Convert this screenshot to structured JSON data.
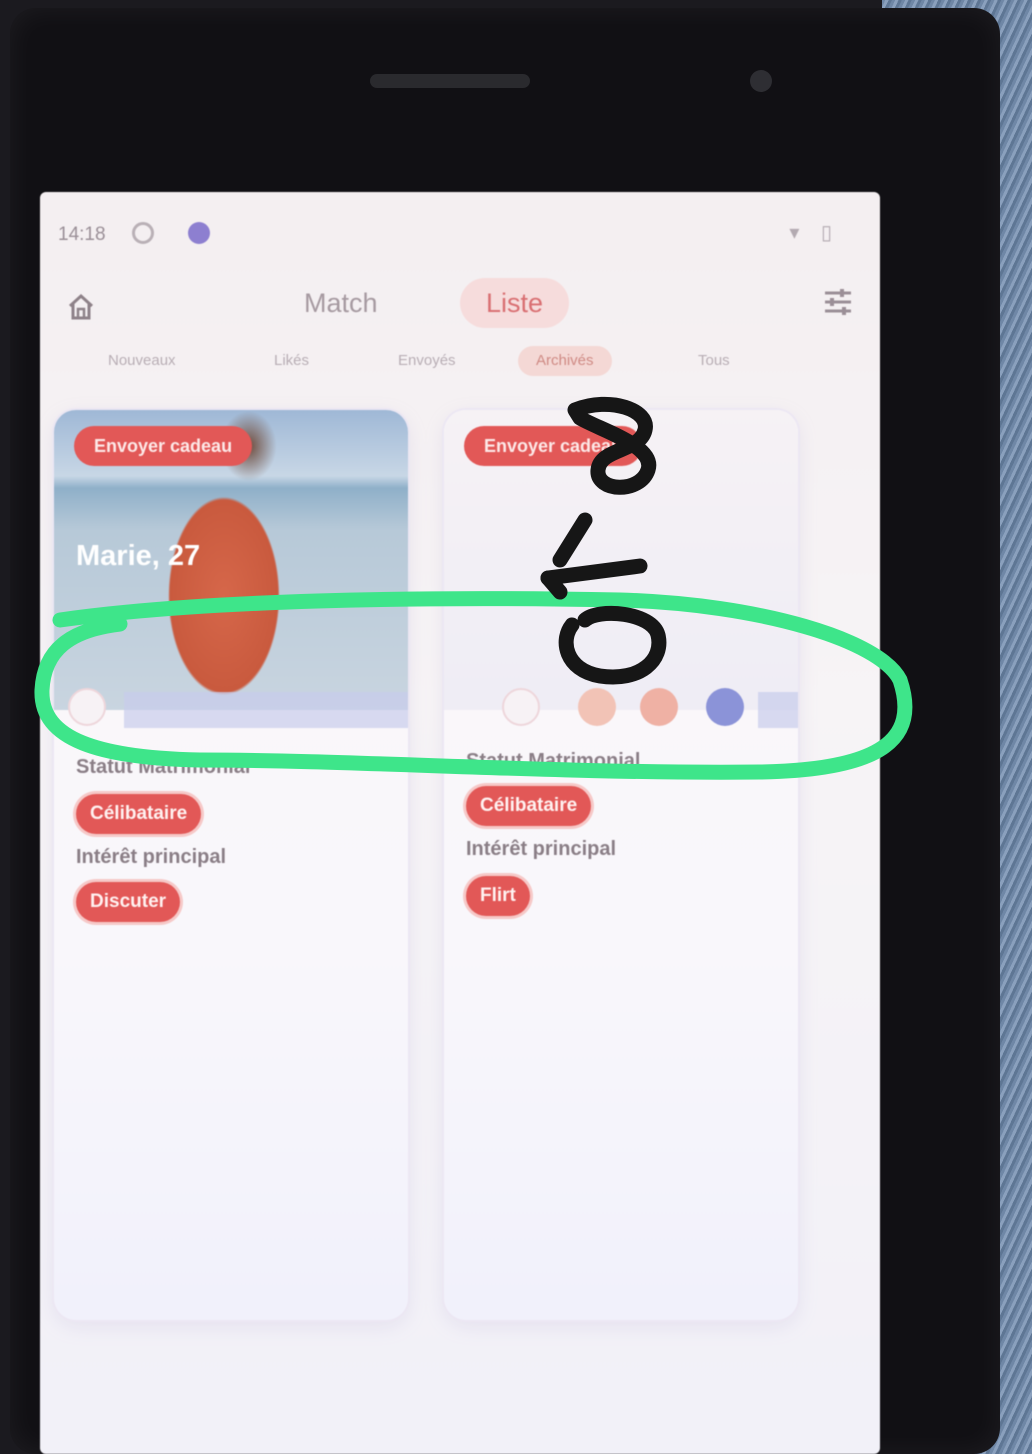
{
  "status_bar": {
    "time": "14:18",
    "right_icons": "▾ ▯"
  },
  "header": {
    "tabs": [
      {
        "label": "Match",
        "active": false
      },
      {
        "label": "Liste",
        "active": true
      }
    ]
  },
  "subtabs": [
    {
      "label": "Nouveaux",
      "active": false
    },
    {
      "label": "Likés",
      "active": false
    },
    {
      "label": "Envoyés",
      "active": false
    },
    {
      "label": "Archivés",
      "active": true
    },
    {
      "label": "Tous",
      "active": false
    }
  ],
  "cards": [
    {
      "gift_button": "Envoyer cadeau",
      "name": "Marie, 27",
      "marital_label": "Statut Matrimonial",
      "marital_value": "Célibataire",
      "interest_label": "Intérêt principal",
      "interest_value": "Discuter"
    },
    {
      "gift_button": "Envoyer cadeau",
      "marital_label": "Statut Matrimonial",
      "marital_value": "Célibataire",
      "interest_label": "Intérêt principal",
      "interest_value": "Flirt"
    }
  ],
  "annotation": {
    "handwritten": "8/10",
    "highlight_color": "#3ee58a",
    "ink_color": "#161616"
  },
  "colors": {
    "accent": "#e25857",
    "tab_active_bg": "#f6dcdc"
  }
}
